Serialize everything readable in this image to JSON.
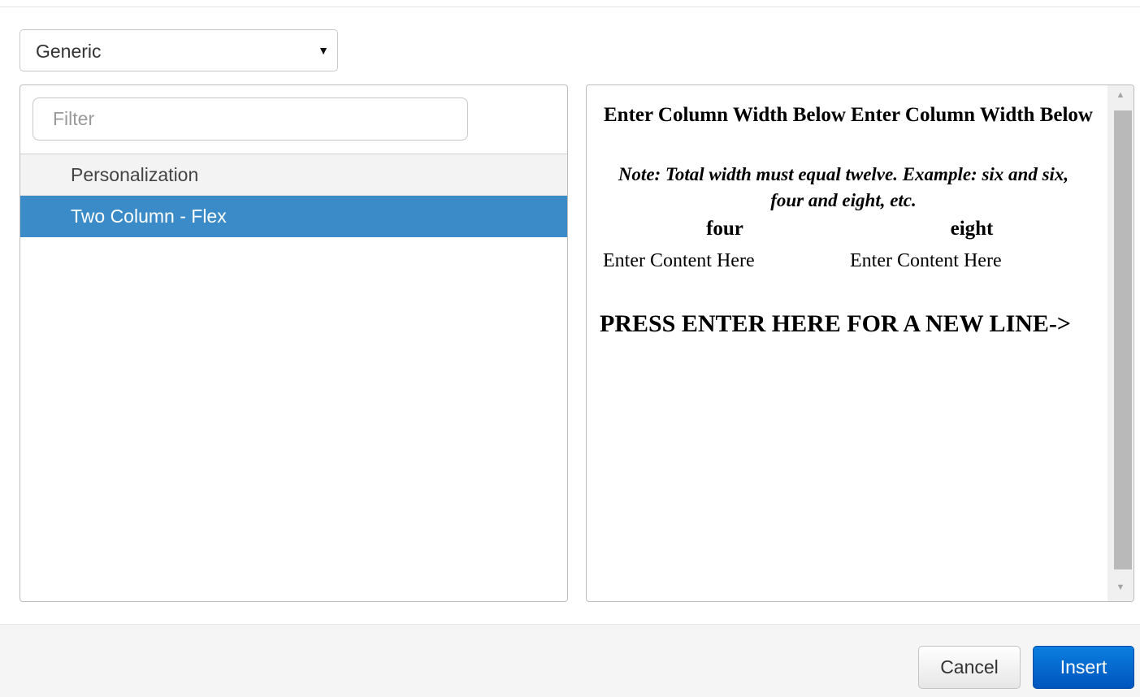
{
  "category_select": {
    "value": "Generic"
  },
  "filter": {
    "placeholder": "Filter",
    "value": ""
  },
  "template_list": {
    "items": [
      {
        "label": "Personalization",
        "selected": false
      },
      {
        "label": "Two Column - Flex",
        "selected": true
      }
    ]
  },
  "preview": {
    "col1_heading": "Enter Column Width Below",
    "col2_heading": "Enter Column Width Below",
    "note": "Note: Total width must equal twelve. Example: six and six, four and eight, etc.",
    "col1_width": "four",
    "col2_width": "eight",
    "col1_content": "Enter Content Here",
    "col2_content": "Enter Content Here",
    "new_line_prompt": "PRESS ENTER HERE FOR A NEW LINE->"
  },
  "footer": {
    "cancel_label": "Cancel",
    "insert_label": "Insert"
  },
  "colors": {
    "selected_item": "#3a8bc7",
    "primary_button": "#0066cc"
  },
  "icons": {
    "select_caret": "▼",
    "scroll_up": "▲",
    "scroll_down": "▼"
  }
}
